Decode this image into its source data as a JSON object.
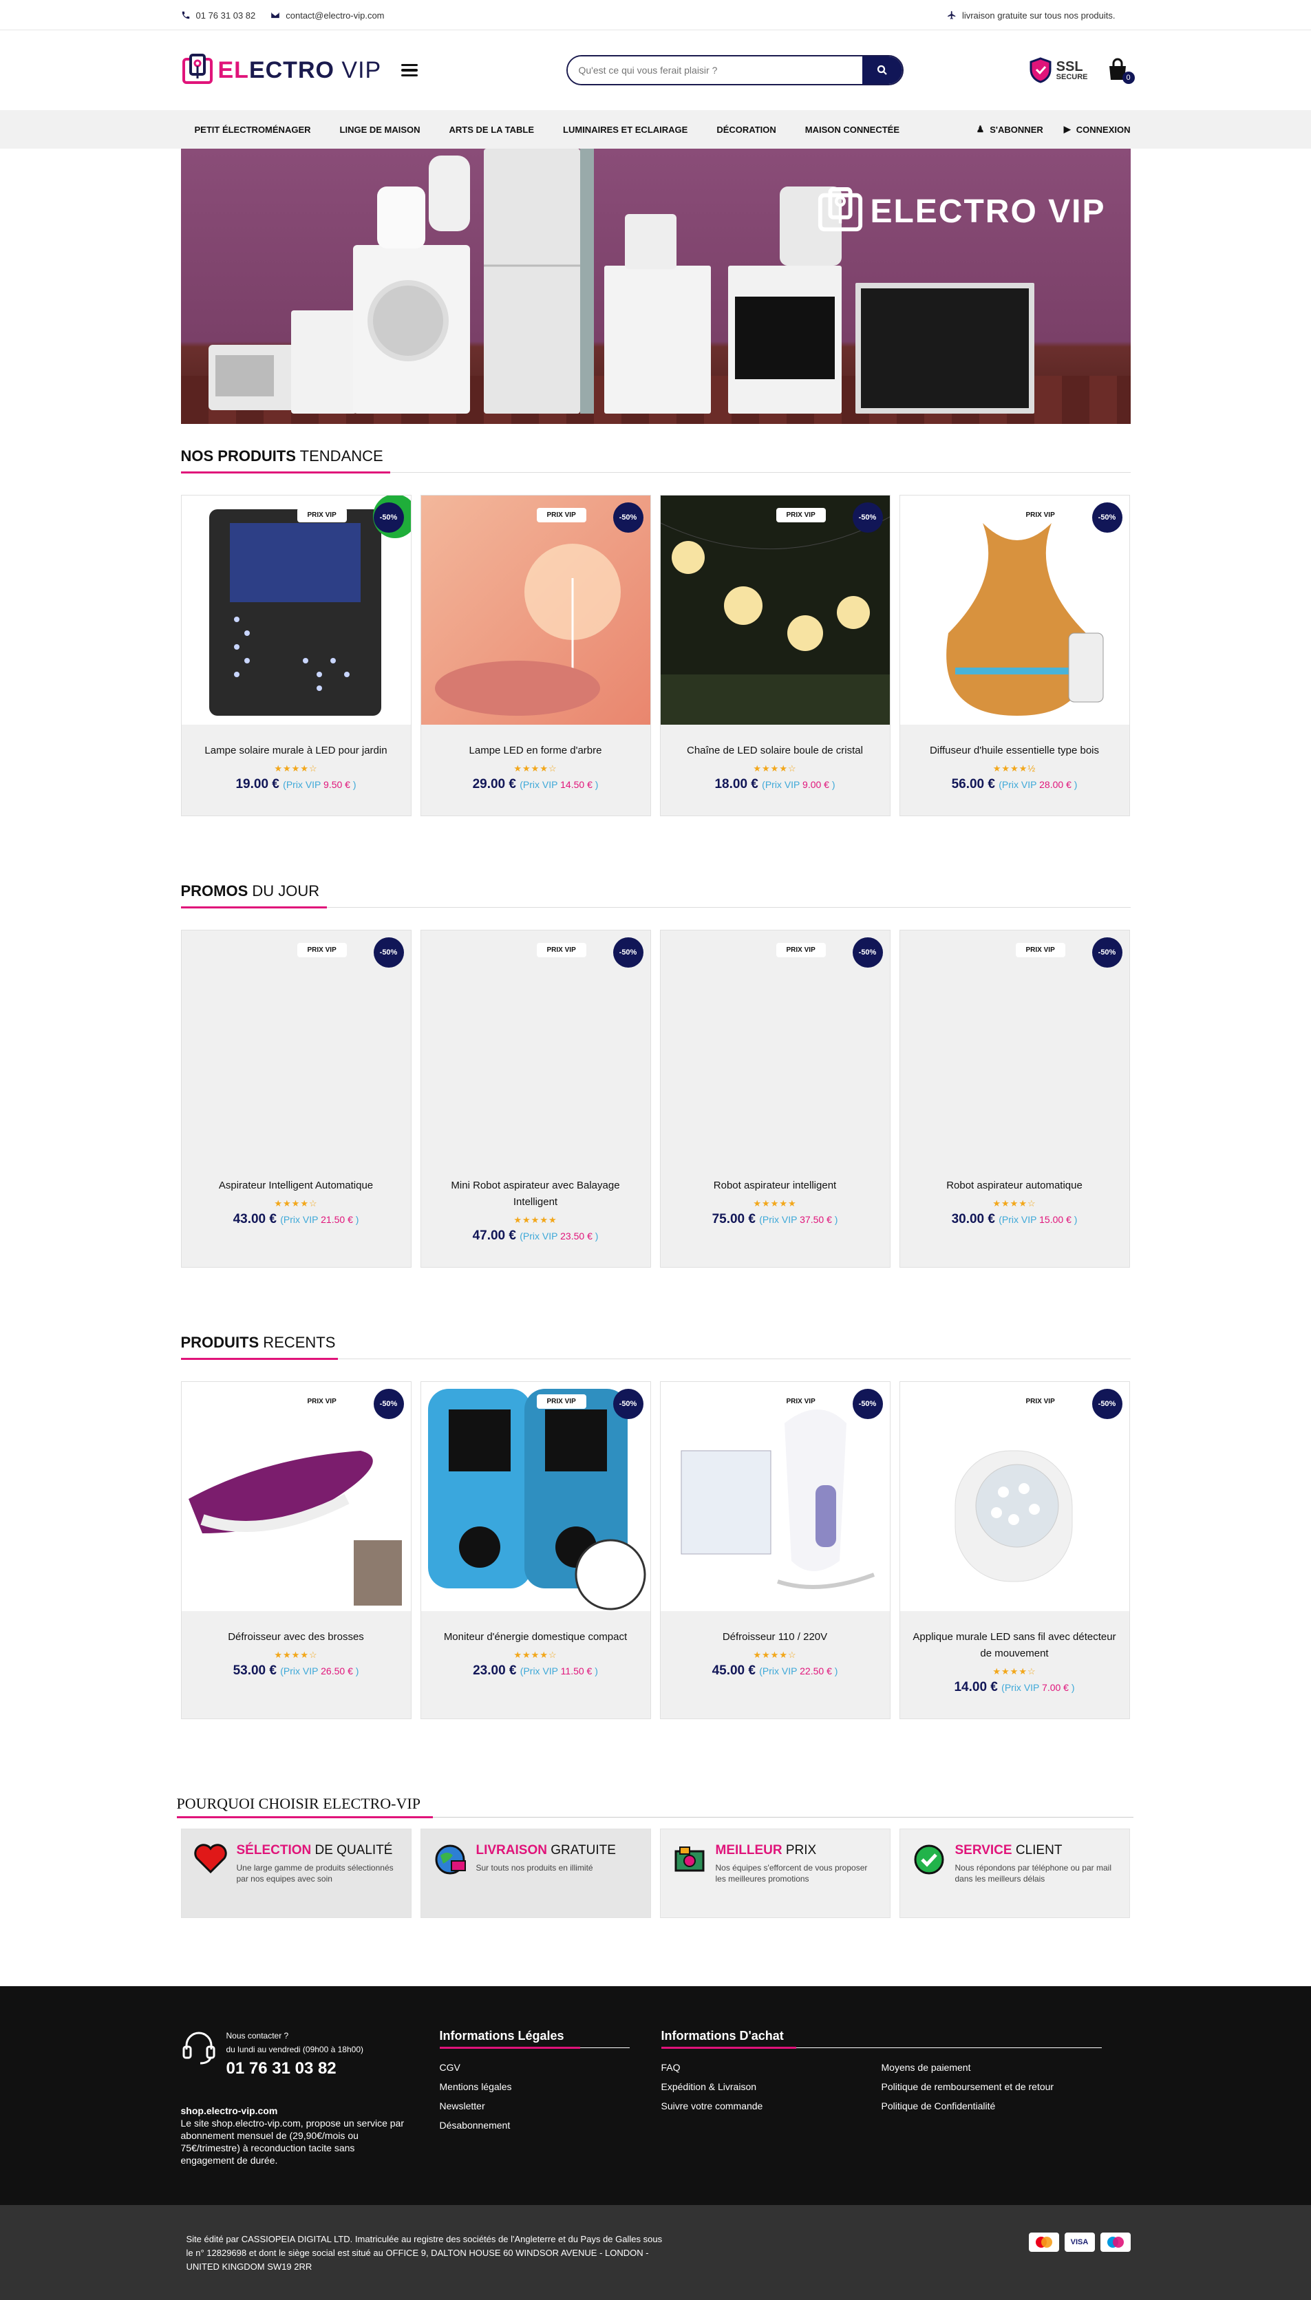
{
  "topbar": {
    "phone": "01 76 31 03 82",
    "email": "contact@electro-vip.com",
    "shipping": "livraison gratuite sur tous nos produits."
  },
  "header": {
    "logo_part1": "EL",
    "logo_part2": "ECTRO",
    "logo_part3": "VIP",
    "search_placeholder": "Qu'est ce qui vous ferait plaisir ?",
    "ssl_title": "SSL",
    "ssl_sub": "SECURE",
    "cart_count": "0"
  },
  "nav": {
    "items": [
      "Petit électroménager",
      "Linge de maison",
      "Arts de la table",
      "Luminaires et eclairage",
      "Décoration",
      "Maison connectée"
    ],
    "subscribe": "S'abonner",
    "login": "Connexion"
  },
  "banner": {
    "logo_text": "ELECTRO VIP"
  },
  "tendance": {
    "title_bold": "NOS PRODUITS",
    "title_rest": " TENDANCE",
    "products": [
      {
        "name": "Lampe solaire murale à LED pour jardin",
        "stars": "★★★★☆",
        "price": "19.00 €",
        "vip": "9.50 €"
      },
      {
        "name": "Lampe LED en forme d'arbre",
        "stars": "★★★★☆",
        "price": "29.00 €",
        "vip": "14.50 €"
      },
      {
        "name": "Chaîne de LED solaire boule de cristal",
        "stars": "★★★★☆",
        "price": "18.00 €",
        "vip": "9.00 €"
      },
      {
        "name": "Diffuseur d'huile essentielle type bois",
        "stars": "★★★★½",
        "price": "56.00 €",
        "vip": "28.00 €"
      }
    ]
  },
  "promos": {
    "title_bold": "PROMOS",
    "title_rest": " DU JOUR",
    "products": [
      {
        "name": "Aspirateur Intelligent Automatique",
        "stars": "★★★★☆",
        "price": "43.00 €",
        "vip": "21.50 €"
      },
      {
        "name": "Mini Robot aspirateur avec Balayage Intelligent",
        "stars": "★★★★★",
        "price": "47.00 €",
        "vip": "23.50 €"
      },
      {
        "name": "Robot aspirateur intelligent",
        "stars": "★★★★★",
        "price": "75.00 €",
        "vip": "37.50 €"
      },
      {
        "name": "Robot aspirateur automatique",
        "stars": "★★★★☆",
        "price": "30.00 €",
        "vip": "15.00 €"
      }
    ]
  },
  "recents": {
    "title_bold": "PRODUITS",
    "title_rest": " RECENTS",
    "products": [
      {
        "name": "Défroisseur avec des brosses",
        "stars": "★★★★☆",
        "price": "53.00 €",
        "vip": "26.50 €"
      },
      {
        "name": "Moniteur d'énergie domestique compact",
        "stars": "★★★★☆",
        "price": "23.00 €",
        "vip": "11.50 €"
      },
      {
        "name": "Défroisseur 110 / 220V",
        "stars": "★★★★☆",
        "price": "45.00 €",
        "vip": "22.50 €"
      },
      {
        "name": "Applique murale LED sans fil avec détecteur de mouvement",
        "stars": "★★★★☆",
        "price": "14.00 €",
        "vip": "7.00 €"
      }
    ]
  },
  "labels": {
    "prix_vip": "PRIX VIP",
    "discount": "-50%",
    "vip_prefix": "(Prix VIP ",
    "vip_suffix": " )"
  },
  "why": {
    "title_bold": "POURQUOI CHOISIR",
    "title_rest": " ELECTRO-VIP",
    "items": [
      {
        "bold": "SÉLECTION",
        "rest": " DE QUALITÉ",
        "text": "Une large gamme de produits sélectionnés par nos equipes avec soin"
      },
      {
        "bold": "LIVRAISON",
        "rest": " GRATUITE",
        "text": "Sur touts nos produits en illimité"
      },
      {
        "bold": "MEILLEUR",
        "rest": " PRIX",
        "text": "Nos équipes s'efforcent de vous proposer les meilleures promotions"
      },
      {
        "bold": "SERVICE",
        "rest": " CLIENT",
        "text": "Nous répondons par téléphone ou par mail dans les meilleurs délais"
      }
    ]
  },
  "footer": {
    "contact_label": "Nous contacter ?",
    "hours": "du lundi au vendredi (09h00 à 18h00)",
    "phone": "01 76 31 03 82",
    "site_name": "shop.electro-vip.com",
    "site_text": "Le site shop.electro-vip.com, propose un service par abonnement mensuel de (29,90€/mois ou 75€/trimestre) à reconduction tacite sans engagement de durée.",
    "legal_title": "Informations Légales",
    "legal_links": [
      "CGV",
      "Mentions légales",
      "Newsletter",
      "Désabonnement"
    ],
    "buy_title": "Informations D'achat",
    "buy_links_1": [
      "FAQ",
      "Expédition & Livraison",
      "Suivre votre commande"
    ],
    "buy_links_2": [
      "Moyens de paiement",
      "Politique de remboursement et de retour",
      "Politique de Confidentialité"
    ],
    "legal_notice": "Site édité par CASSIOPEIA DIGITAL LTD. Imatriculée au registre des sociétés de l'Angleterre et du Pays de Galles sous le n° 12829698 et dont le siège social est situé au OFFICE 9, DALTON HOUSE 60 WINDSOR AVENUE - LONDON - UNITED KINGDOM SW19 2RR",
    "payment_cards": [
      "mastercard",
      "VISA",
      "Maestro"
    ]
  },
  "colors": {
    "brand_navy": "#111657",
    "brand_pink": "#e0147a",
    "star": "#f2a71b"
  }
}
